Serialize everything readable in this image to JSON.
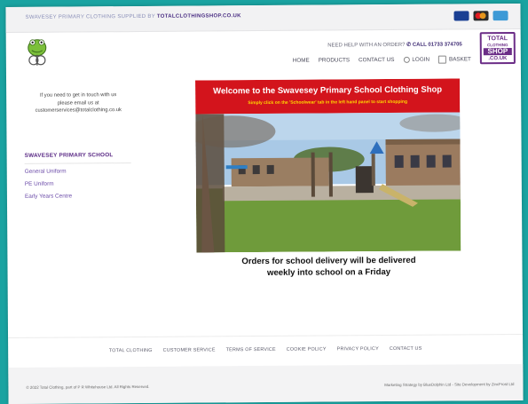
{
  "topbar": {
    "supplied_text": "SWAVESEY PRIMARY CLOTHING SUPPLIED BY ",
    "supplied_brand": "TOTALCLOTHINGSHOP.CO.UK",
    "payment_icons": [
      "visa-card-icon",
      "mastercard-icon",
      "amex-card-icon"
    ]
  },
  "header": {
    "help_text": "NEED HELP WITH AN ORDER?",
    "phone": "CALL 01733 374705",
    "nav": {
      "home": "HOME",
      "products": "PRODUCTS",
      "contact": "CONTACT US",
      "login": "LOGIN",
      "basket": "BASKET"
    },
    "brand_logo": {
      "line1": "TOTAL",
      "line2": "CLOTHING",
      "line3": "SHOP",
      "line4": ".CO.UK"
    },
    "brand_color": "#6b2d87"
  },
  "sidebar": {
    "contact_line1": "If you need to get in touch with us",
    "contact_line2": "please email us at",
    "contact_email": "customerservices@totalclothing.co.uk",
    "school_title": "SWAVESEY PRIMARY SCHOOL",
    "links": [
      "General Uniform",
      "PE Uniform",
      "Early Years Centre"
    ]
  },
  "banner": {
    "title": "Welcome to the Swavesey Primary School Clothing Shop",
    "subtitle": "Simply click on the 'Schoolwear' tab in the left hand panel to start shopping",
    "accent": "#d3141c"
  },
  "notice": {
    "line1": "Orders for school delivery will be delivered",
    "line2": "weekly into school on a Friday"
  },
  "footer": {
    "links": [
      "TOTAL CLOTHING",
      "CUSTOMER SERVICE",
      "TERMS OF SERVICE",
      "COOKIE POLICY",
      "PRIVACY POLICY",
      "CONTACT US"
    ],
    "copyright": "© 2022 Total Clothing, part of P R Whitehouse Ltd. All Rights Reserved.",
    "credit": "Marketing Strategy by BlueDolphin Ltd - Site Development by ZincFrost Ltd"
  }
}
